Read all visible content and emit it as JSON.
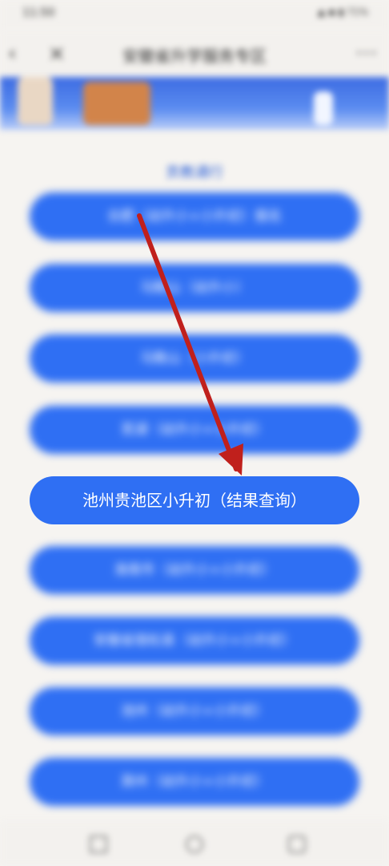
{
  "status_bar": {
    "time": "11:50",
    "icons": "▲ ◆ ▮ 71%"
  },
  "header": {
    "title": "安徽省升学服务专区",
    "back_icon": "chevron-left-icon",
    "close_icon": "close-icon",
    "more_icon": "more-icon"
  },
  "section": {
    "title": "贡教通行"
  },
  "buttons": [
    "合肥（幼升小+小升初）报名",
    "马鞍山（幼升小）",
    "马鞍山（小升初）",
    "芜湖（幼升小+小升初）",
    "池州贵池区小升初（结果查询）",
    "淮南市（幼升小+小升初）",
    "安徽省宿松县（幼升小+小升初）",
    "池州（幼升小+小升初）",
    "滁州（幼升小+小升初）"
  ],
  "colors": {
    "button_blue": "#2f6ff3",
    "arrow_red": "#c0201c",
    "section_blue": "#2f63d8"
  }
}
